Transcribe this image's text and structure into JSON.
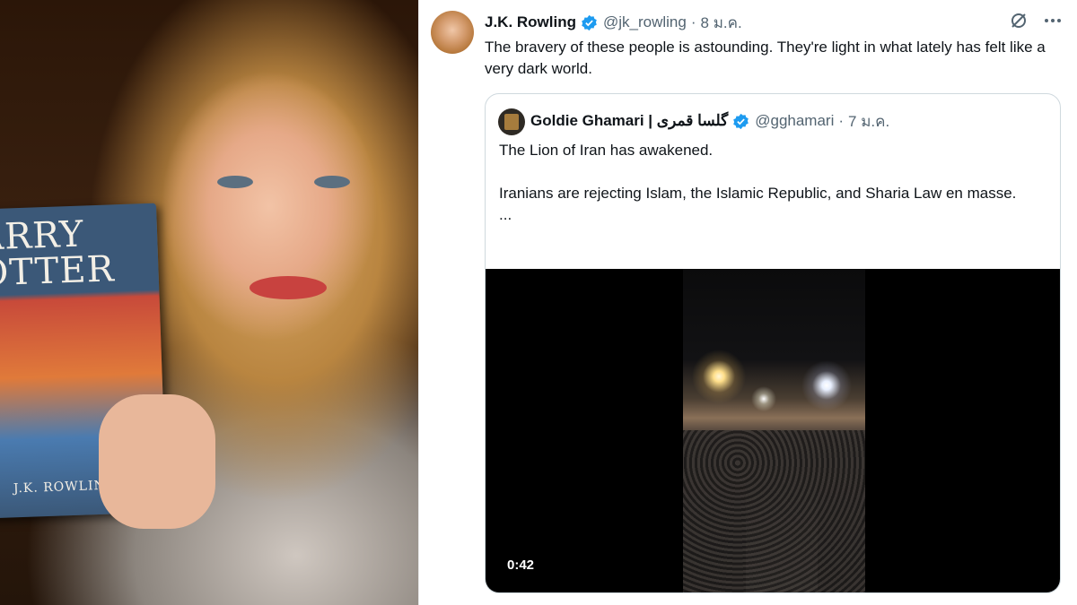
{
  "tweet": {
    "author_name": "J.K. Rowling",
    "handle": "@jk_rowling",
    "separator": "·",
    "date": "8 ม.ค.",
    "text": "The bravery of these people is astounding. They're light in what lately has felt like a very dark world."
  },
  "quoted_tweet": {
    "author_name": "Goldie Ghamari | گلسا قمری",
    "handle": "@gghamari",
    "separator": "·",
    "date": "7 ม.ค.",
    "line1": "The Lion of Iran has awakened.",
    "line2": "Iranians are rejecting Islam, the Islamic Republic, and Sharia Law en masse.",
    "line3": "...",
    "video_duration": "0:42"
  },
  "photo": {
    "book_title": "ARRY\nOTTER",
    "book_author": "J.K. ROWLING"
  },
  "colors": {
    "verified": "#1d9bf0",
    "text": "#0f1419",
    "muted": "#536471",
    "border": "#cfd9de"
  },
  "icons": [
    "verified-badge-icon",
    "grok-icon",
    "more-icon"
  ]
}
